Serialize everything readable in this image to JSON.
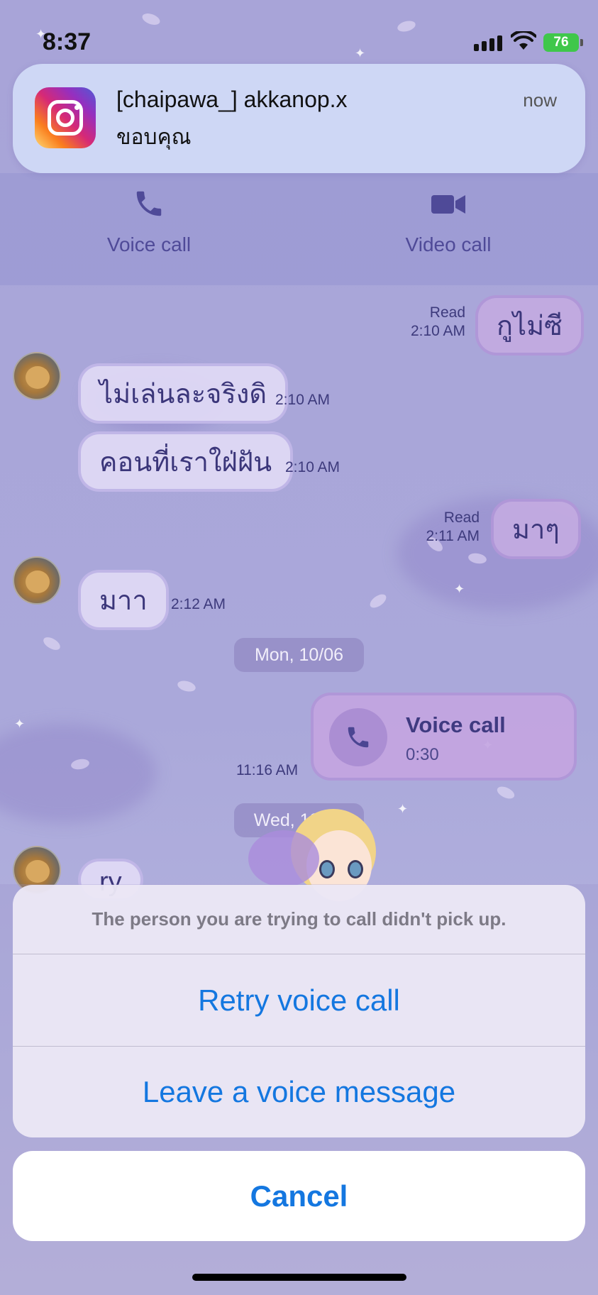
{
  "status_bar": {
    "time": "8:37",
    "battery": "76"
  },
  "notification": {
    "app_icon": "instagram-icon",
    "title": "[chaipawa_] akkanop.x",
    "body": "ขอบคุณ",
    "time": "now"
  },
  "call_actions": {
    "voice_label": "Voice call",
    "video_label": "Video call"
  },
  "messages": [
    {
      "direction": "out",
      "text": "กูไม่ซี",
      "status": "Read",
      "time": "2:10 AM"
    },
    {
      "direction": "in",
      "text": "ไม่เล่นละจริงดิ",
      "time": "2:10 AM"
    },
    {
      "direction": "in",
      "text": "คอนที่เราใฝ่ฝัน",
      "time": "2:10 AM"
    },
    {
      "direction": "out",
      "text": "มาๆ",
      "status": "Read",
      "time": "2:11 AM"
    },
    {
      "direction": "in",
      "text": "มาา",
      "time": "2:12 AM"
    }
  ],
  "date_separators": [
    "Mon, 10/06",
    "Wed, 12/06"
  ],
  "call_card": {
    "title": "Voice call",
    "duration": "0:30",
    "time": "11:16 AM"
  },
  "partial_message": "ry",
  "action_sheet": {
    "message": "The person you are trying to call didn't pick up.",
    "retry_label": "Retry voice call",
    "voicemail_label": "Leave a voice message",
    "cancel_label": "Cancel"
  }
}
